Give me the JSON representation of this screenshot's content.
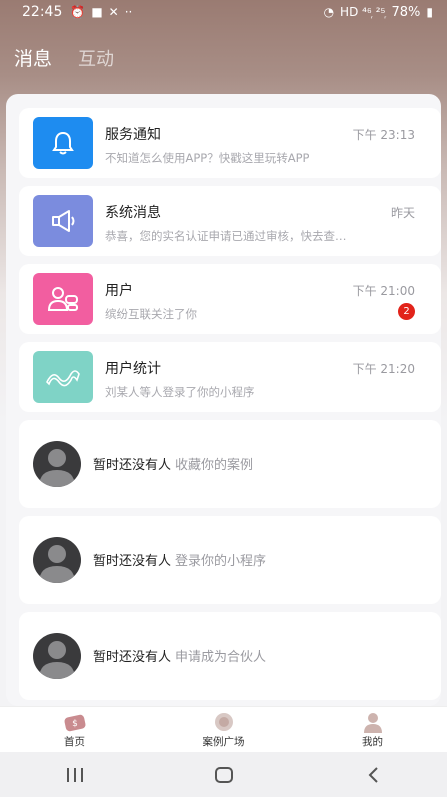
{
  "status_bar": {
    "time": "22:45",
    "signal": "HD ⁴⁶᷊ ²⁵᷊",
    "battery": "78%"
  },
  "tabs": [
    {
      "label": "消息",
      "active": true
    },
    {
      "label": "互动",
      "active": false
    }
  ],
  "messages": [
    {
      "title": "服务通知",
      "subtitle": "不知道怎么使用APP？快戳这里玩转APP",
      "time": "下午 23:13",
      "icon": "bell-icon",
      "color": "#1e8cf0"
    },
    {
      "title": "系统消息",
      "subtitle": "恭喜，您的实名认证申请已通过审核，快去查…",
      "time": "昨天",
      "icon": "megaphone-icon",
      "color": "#7b8cde"
    },
    {
      "title": "用户",
      "subtitle": "缤纷互联关注了你",
      "time": "下午 21:00",
      "badge": "2",
      "icon": "users-icon",
      "color": "#f25ea0"
    },
    {
      "title": "用户统计",
      "subtitle": "刘某人等人登录了你的小程序",
      "time": "下午 21:20",
      "icon": "wave-icon",
      "color": "#7fd3c6"
    }
  ],
  "empty_items": [
    {
      "name": "暂时还没有人",
      "action": "收藏你的案例"
    },
    {
      "name": "暂时还没有人",
      "action": "登录你的小程序"
    },
    {
      "name": "暂时还没有人",
      "action": "申请成为合伙人"
    }
  ],
  "bottom_nav": [
    {
      "label": "首页",
      "icon": "home-icon"
    },
    {
      "label": "案例广场",
      "icon": "case-square-icon"
    },
    {
      "label": "我的",
      "icon": "profile-icon"
    }
  ]
}
